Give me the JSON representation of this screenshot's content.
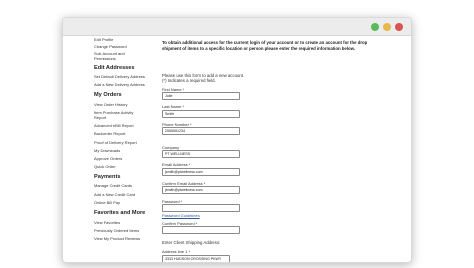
{
  "sidebar": {
    "top_items": [
      "Edit Profile",
      "Change Password",
      "Sub-Account and",
      "Permissions"
    ],
    "sections": [
      {
        "heading": "Edit Addresses",
        "items": [
          "Set Default Delivery Address",
          "Add a New Delivery Address"
        ]
      },
      {
        "heading": "My Orders",
        "items": [
          "View Order History",
          "Item Purchase Activity",
          "Report",
          "Advanced eBill Report",
          "Backorder Report",
          "Proof of Delivery Report",
          "My Downloads",
          "Approve Orders",
          "Quick Order"
        ]
      },
      {
        "heading": "Payments",
        "items": [
          "Manage Credit Cards",
          "Add a New Credit Card",
          "Online Bill Pay"
        ]
      },
      {
        "heading": "Favorites and More",
        "items": [
          "View Favorites",
          "Previously Ordered Items",
          "View My Product Reviews"
        ]
      }
    ]
  },
  "form": {
    "intro": "To obtain additional access for the current login of your account or to create an account for the drop shipment of items to a specific location or person please enter the required information below.",
    "note_line1": "Please use this form to add a new account.",
    "note_line2": "(*) Indicates a required field.",
    "fields": [
      {
        "label": "First Name *",
        "value": "Julie"
      },
      {
        "label": "Last Name *",
        "value": "Smith"
      },
      {
        "label": "Phone Number *",
        "value": "2065551234"
      },
      {
        "label": "Company",
        "value": "PT WELLNESS"
      },
      {
        "label": "Email Address *",
        "value": "jsmith@ptwellness.com"
      },
      {
        "label": "Confirm Email Address *",
        "value": "jsmith@ptwellness.com"
      },
      {
        "label": "Password *",
        "value": ""
      },
      {
        "label": "Confirm Password *",
        "value": ""
      }
    ],
    "password_link": "Password Guidelines",
    "shipping_label": "Enter Client Shipping Address:",
    "address_label": "Address line 1 *",
    "address_value": "3333 HUDSON CROSSING PKWY"
  }
}
